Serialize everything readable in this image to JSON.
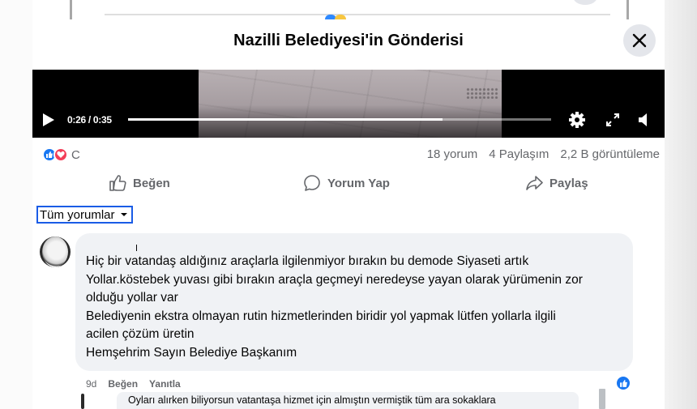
{
  "dialog": {
    "title": "Nazilli Belediyesi'in Gönderisi",
    "close_icon": "close-icon"
  },
  "video": {
    "time": "0:26 / 0:35",
    "progress": 0.743,
    "icons": [
      "play-icon",
      "settings-icon",
      "fullscreen-icon",
      "volume-icon"
    ]
  },
  "stats": {
    "reaction_count": "C",
    "comments": "18 yorum",
    "shares": "4 Paylaşım",
    "views": "2,2 B görüntüleme"
  },
  "actions": {
    "like": "Beğen",
    "comment": "Yorum Yap",
    "share": "Paylaş"
  },
  "filter": {
    "label": "Tüm yorumlar"
  },
  "comment": {
    "author": "",
    "lines": [
      "Hiç bir vatandaş aldığınız araçlarla ilgilenmiyor bırakın bu demode Siyaseti artık",
      "Yollar.köstebek yuvası gibi bırakın araçla geçmeyi neredeyse yayan olarak yürümenin zor",
      "olduğu yollar var",
      "Belediyenin ekstra olmayan rutin hizmetlerinden biridir yol yapmak lütfen yollarla ilgili",
      "acilen çözüm üretin",
      "Hemşehrim Sayın Belediye Başkanım"
    ],
    "time": "9d",
    "like_label": "Beğen",
    "reply_label": "Yanıtla"
  },
  "reply_preview": {
    "text": "Oyları alırken biliyorsun vatantaşa hizmet için almıştın vermiştik tüm ara sokaklara"
  },
  "colors": {
    "accent": "#1877f2",
    "love": "#f33e58",
    "secondary_text": "#65676b",
    "bubble": "#f0f2f5"
  }
}
